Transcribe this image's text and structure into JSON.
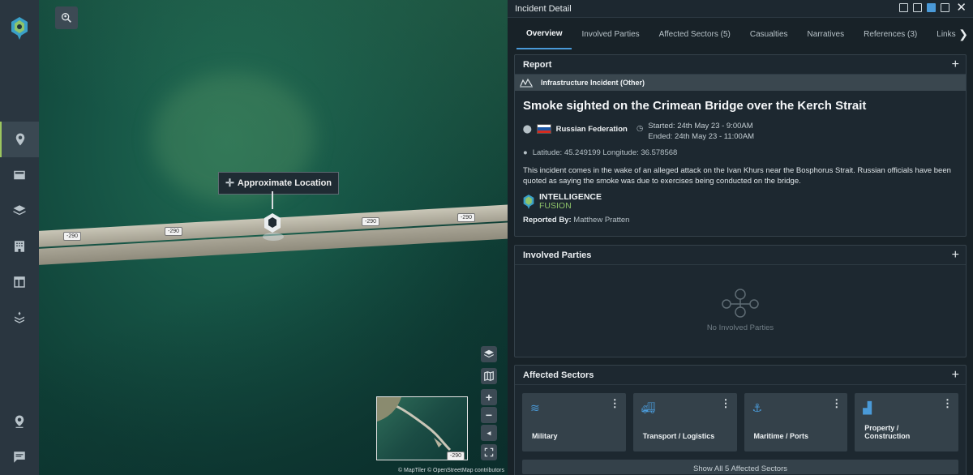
{
  "map": {
    "location_label": "Approximate Location",
    "road_signs": [
      "-290",
      "-290",
      "-290",
      "-290"
    ],
    "minimap_sign": "-290",
    "attribution": "© MapTiler © OpenStreetMap contributors",
    "controls": [
      "layers-icon",
      "map-icon",
      "zoom-in",
      "zoom-out",
      "compass-icon",
      "fullscreen-icon"
    ],
    "zoom_in": "+",
    "zoom_out": "−"
  },
  "panel": {
    "title": "Incident Detail",
    "tabs": [
      {
        "label": "Overview",
        "active": true
      },
      {
        "label": "Involved Parties"
      },
      {
        "label": "Affected Sectors (5)"
      },
      {
        "label": "Casualties"
      },
      {
        "label": "Narratives"
      },
      {
        "label": "References (3)"
      },
      {
        "label": "Links"
      }
    ]
  },
  "report": {
    "header": "Report",
    "type": "Infrastructure Incident (Other)",
    "title": "Smoke sighted on the Crimean Bridge over the Kerch Strait",
    "country": "Russian Federation",
    "started": "Started: 24th May 23 - 9:00AM",
    "ended": "Ended: 24th May 23 - 11:00AM",
    "coordinates": "Latitude: 45.249199 Longitude: 36.578568",
    "description": "This incident comes in the wake of an alleged attack on the Ivan Khurs near the Bosphorus Strait. Russian officials have been quoted as saying the smoke was due to exercises being conducted on the bridge.",
    "brand_line1": "INTELLIGENCE",
    "brand_line2": "FUSION",
    "reported_by_label": "Reported By:",
    "reported_by": "Matthew Pratten"
  },
  "involved_parties": {
    "header": "Involved Parties",
    "empty_text": "No Involved Parties"
  },
  "affected_sectors": {
    "header": "Affected Sectors",
    "items": [
      {
        "label": "Military",
        "icon": "military-icon"
      },
      {
        "label": "Transport / Logistics",
        "icon": "truck-icon"
      },
      {
        "label": "Maritime / Ports",
        "icon": "anchor-icon"
      },
      {
        "label": "Property / Construction",
        "icon": "buildings-icon"
      }
    ],
    "show_all": "Show All 5 Affected Sectors"
  },
  "colors": {
    "accent": "#4a9ad8",
    "brand_green": "#8fc46a"
  }
}
